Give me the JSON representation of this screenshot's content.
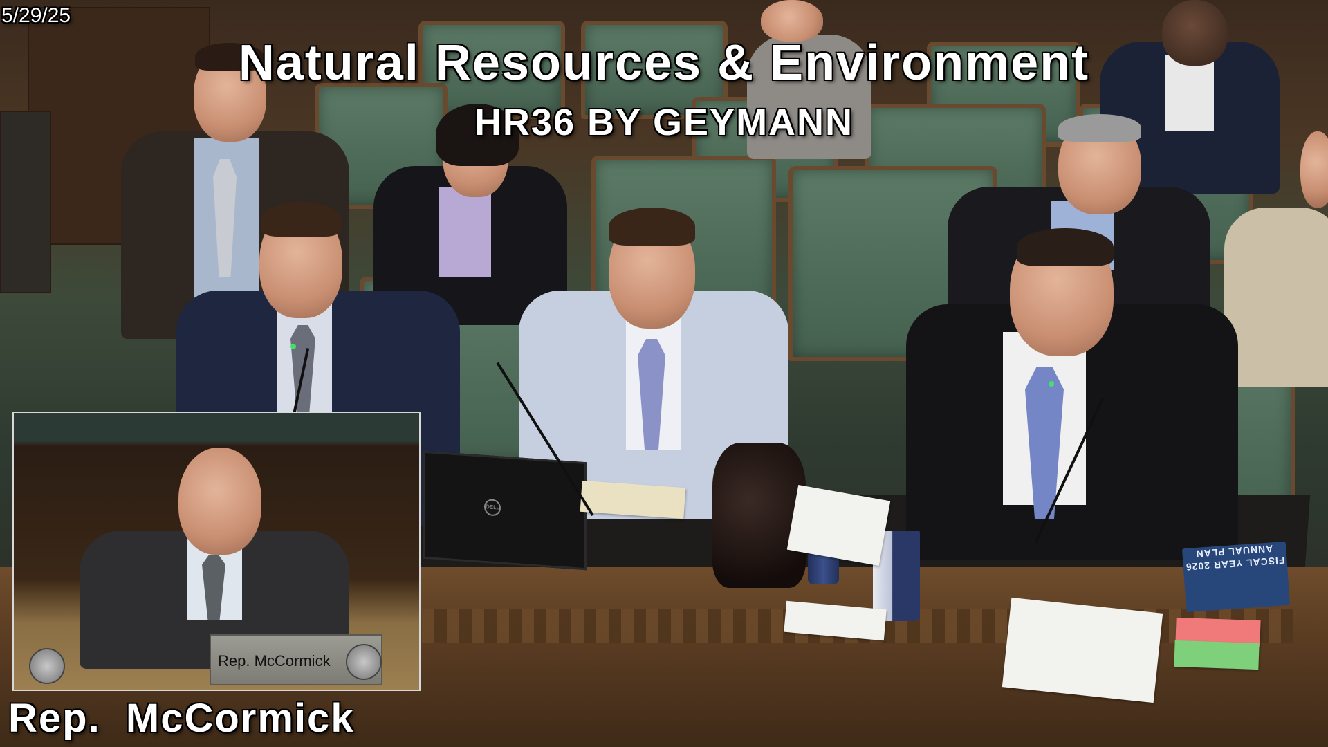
{
  "overlay": {
    "date": "5/29/25",
    "title": "Natural Resources & Environment",
    "subtitle": "HR36 BY GEYMANN",
    "speaker_caption": "Rep.  McCormick"
  },
  "pip": {
    "nameplate": "Rep. McCormick"
  },
  "scene": {
    "book_cover": "FISCAL YEAR 2026 ANNUAL PLAN",
    "laptop_brand": "DELL"
  },
  "colors": {
    "chair_green": "#4f6e5a",
    "wood": "#5a3c22",
    "overlay_text": "#ffffff",
    "status_led": "#2de05a"
  }
}
